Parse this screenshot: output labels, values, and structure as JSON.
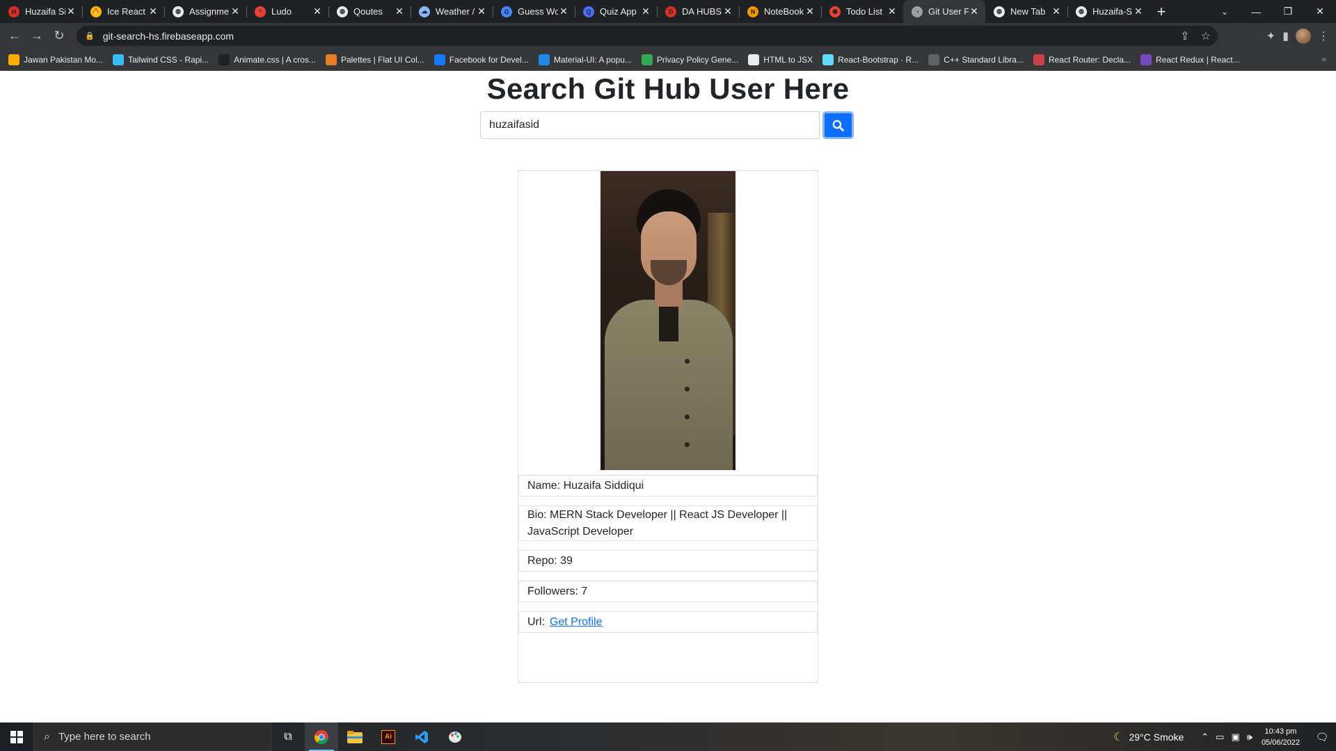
{
  "browser": {
    "tabs": [
      {
        "title": "Huzaifa Si",
        "color": "#d93025",
        "glyph": "H"
      },
      {
        "title": "Ice React",
        "color": "#fbbc04",
        "glyph": "🔥"
      },
      {
        "title": "Assignme",
        "color": "#e8eaed",
        "glyph": "◍"
      },
      {
        "title": "Ludo",
        "color": "#ea4335",
        "glyph": "⁘"
      },
      {
        "title": "Qoutes",
        "color": "#e8eaed",
        "glyph": "◍"
      },
      {
        "title": "Weather /",
        "color": "#8ab4f8",
        "glyph": "☁"
      },
      {
        "title": "Guess Wo",
        "color": "#4285f4",
        "glyph": "G"
      },
      {
        "title": "Quiz App",
        "color": "#4c6ef5",
        "glyph": "Q"
      },
      {
        "title": "DA HUBS",
        "color": "#d93025",
        "glyph": "D"
      },
      {
        "title": "NoteBook",
        "color": "#f29900",
        "glyph": "N"
      },
      {
        "title": "Todo List",
        "color": "#ea4335",
        "glyph": "◉"
      },
      {
        "title": "Git User F",
        "color": "#9aa0a6",
        "glyph": "◔",
        "active": true
      },
      {
        "title": "New Tab",
        "color": "#e8eaed",
        "glyph": "◍"
      },
      {
        "title": "Huzaifa-S",
        "color": "#e8eaed",
        "glyph": "◍"
      }
    ],
    "url": "git-search-hs.firebaseapp.com",
    "bookmarks": [
      {
        "label": "Jawan Pakistan Mo...",
        "color": "#f9ab00"
      },
      {
        "label": "Tailwind CSS - Rapi...",
        "color": "#38bdf8"
      },
      {
        "label": "Animate.css | A cros...",
        "color": "#202124"
      },
      {
        "label": "Palettes | Flat UI Col...",
        "color": "#e67e22"
      },
      {
        "label": "Facebook for Devel...",
        "color": "#1877f2"
      },
      {
        "label": "Material-UI: A popu...",
        "color": "#1e88e5"
      },
      {
        "label": "Privacy Policy Gene...",
        "color": "#34a853"
      },
      {
        "label": "HTML to JSX",
        "color": "#e8eaed"
      },
      {
        "label": "React-Bootstrap · R...",
        "color": "#61dafb"
      },
      {
        "label": "C++ Standard Libra...",
        "color": "#5f6368"
      },
      {
        "label": "React Router: Decla...",
        "color": "#ca4245"
      },
      {
        "label": "React Redux | React...",
        "color": "#764abc"
      }
    ]
  },
  "app": {
    "heading": "Search Git Hub User Here",
    "search_value": "huzaifasid",
    "accent": "#0d6efd",
    "profile": {
      "name": "Name: Huzaifa Siddiqui",
      "bio": "Bio: MERN Stack Developer || React JS Developer || JavaScript Developer",
      "repo": "Repo: 39",
      "followers": "Followers: 7",
      "url_label": "Url:",
      "url_link": "Get Profile"
    }
  },
  "taskbar": {
    "search_placeholder": "Type here to search",
    "weather": "29°C  Smoke",
    "time": "10:43 pm",
    "date": "05/06/2022"
  }
}
